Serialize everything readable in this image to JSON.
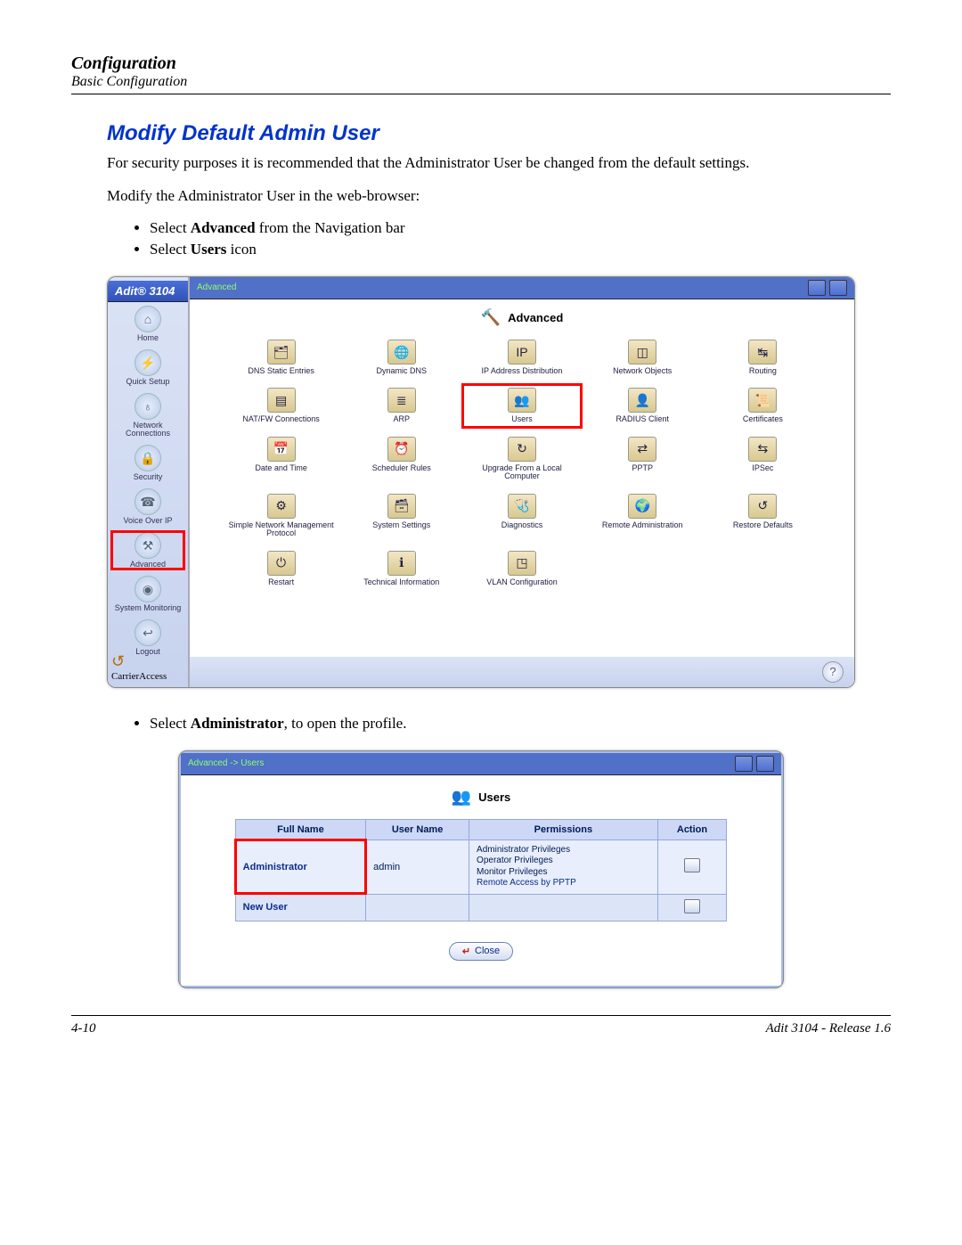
{
  "header": {
    "chapter": "Configuration",
    "section": "Basic Configuration"
  },
  "heading": "Modify Default Admin User",
  "paragraph_1": "For security purposes it is recommended that the Administrator User be changed from the default settings.",
  "paragraph_2": "Modify the Administrator User in the web-browser:",
  "bullets_top": {
    "b1_pre": "Select ",
    "b1_bold": "Advanced",
    "b1_post": " from the Navigation bar",
    "b2_pre": "Select ",
    "b2_bold": "Users",
    "b2_post": " icon"
  },
  "screenshot1": {
    "product": "Adit® 3104",
    "breadcrumb": "Advanced",
    "main_title": "Advanced",
    "nav": {
      "home": "Home",
      "quick": "Quick Setup",
      "net": "Network Connections",
      "sec": "Security",
      "voip": "Voice Over IP",
      "adv": "Advanced",
      "mon": "System Monitoring",
      "logout": "Logout"
    },
    "brand": "CarrierAccess",
    "items": {
      "dns_static": "DNS Static Entries",
      "dyn_dns": "Dynamic DNS",
      "ip_dist": "IP Address Distribution",
      "net_obj": "Network Objects",
      "routing": "Routing",
      "natfw": "NAT/FW Connections",
      "arp": "ARP",
      "users": "Users",
      "radius": "RADIUS Client",
      "certs": "Certificates",
      "datetime": "Date and Time",
      "sched": "Scheduler Rules",
      "upgrade": "Upgrade From a Local Computer",
      "pptp": "PPTP",
      "ipsec": "IPSec",
      "snmp": "Simple Network Management Protocol",
      "sysset": "System Settings",
      "diag": "Diagnostics",
      "remadm": "Remote Administration",
      "restore": "Restore Defaults",
      "restart": "Restart",
      "techinfo": "Technical Information",
      "vlan": "VLAN Configuration"
    }
  },
  "bullet_mid": {
    "pre": "Select ",
    "bold": "Administrator",
    "post": ", to open the profile."
  },
  "screenshot2": {
    "breadcrumb": "Advanced -> Users",
    "title": "Users",
    "headers": {
      "full": "Full Name",
      "user": "User Name",
      "perm": "Permissions",
      "action": "Action"
    },
    "row": {
      "full": "Administrator",
      "user": "admin",
      "perms": {
        "p1": "Administrator Privileges",
        "p2": "Operator Privileges",
        "p3": "Monitor Privileges",
        "p4": "Remote Access by PPTP"
      }
    },
    "new_user": "New User",
    "close": "Close"
  },
  "footer": {
    "left": "4-10",
    "right": "Adit 3104 - Release 1.6"
  }
}
